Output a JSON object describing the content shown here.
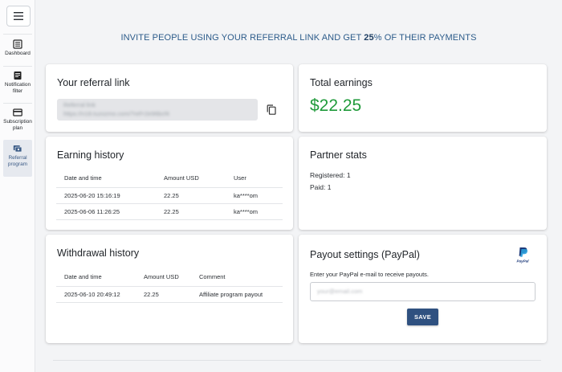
{
  "sidebar": {
    "items": [
      {
        "label": "Dashboard",
        "icon": "dashboard-icon"
      },
      {
        "label": "Notification filter",
        "icon": "note-icon"
      },
      {
        "label": "Subscription plan",
        "icon": "credit-card-icon"
      },
      {
        "label": "Referral program",
        "icon": "referral-icon",
        "active": true
      }
    ]
  },
  "headline": {
    "prefix": "INVITE PEOPLE USING YOUR REFERRAL LINK AND GET ",
    "percent": "25",
    "suffix": "% OF THEIR PAYMENTS"
  },
  "referral": {
    "title": "Your referral link",
    "label": "Referral link",
    "link": "https://n18.tuzozmo.com/?ref=2e96bcf4"
  },
  "total": {
    "title": "Total earnings",
    "value": "$22.25"
  },
  "earning_history": {
    "title": "Earning history",
    "columns": [
      "Date and time",
      "Amount USD",
      "User"
    ],
    "rows": [
      [
        "2025-06-20 15:16:19",
        "22.25",
        "ka****om"
      ],
      [
        "2025-06-06 11:26:25",
        "22.25",
        "ka****om"
      ]
    ]
  },
  "partner_stats": {
    "title": "Partner stats",
    "registered_label": "Registered: 1",
    "paid_label": "Paid: 1"
  },
  "withdrawal_history": {
    "title": "Withdrawal history",
    "columns": [
      "Date and time",
      "Amount USD",
      "Comment"
    ],
    "rows": [
      [
        "2025-06-10 20:49:12",
        "22.25",
        "Affiliate program payout"
      ]
    ]
  },
  "payout": {
    "title": "Payout settings (PayPal)",
    "description": "Enter your PayPal e-mail to receive payouts.",
    "email_placeholder": "your@email.com",
    "email_value": "",
    "save_label": "SAVE",
    "logo_text": "PayPal"
  },
  "colors": {
    "accent": "#2f5180",
    "earnings": "#1f9a3a",
    "headline": "#2c5b8a"
  }
}
